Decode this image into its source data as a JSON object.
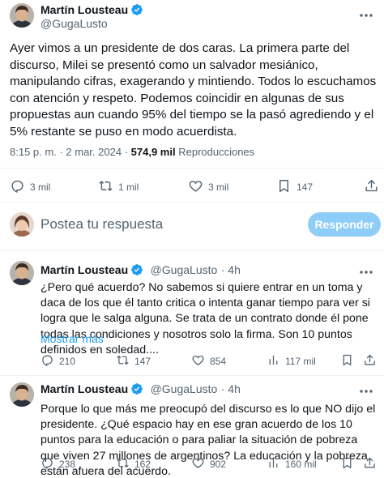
{
  "main_post": {
    "author_name": "Martín Lousteau",
    "author_handle": "@GugaLusto",
    "text": "Ayer vimos a un presidente de dos caras. La primera parte del discurso, Milei se presentó como un salvador mesiánico, manipulando cifras, exagerando y mintiendo. Todos lo escuchamos con atención y respeto. Podemos coincidir en algunas de sus propuestas aun cuando 95% del tiempo se la pasó agrediendo y el 5% restante se puso en modo acuerdista.",
    "time": "8:15 p. m.",
    "separator": "·",
    "date": "2 mar. 2024",
    "views_count": "574,9 mil",
    "views_label": "Reproducciones",
    "actions": {
      "replies": "3 mil",
      "reposts": "1 mil",
      "likes": "3 mil",
      "bookmarks": "147"
    }
  },
  "composer": {
    "placeholder": "Postea tu respuesta",
    "button_label": "Responder"
  },
  "replies": [
    {
      "author_name": "Martín Lousteau",
      "author_handle": "@GugaLusto",
      "age": "· 4h",
      "text": "¿Pero qué acuerdo? No sabemos si quiere entrar en un toma y daca de los que él tanto critica o intenta ganar tiempo para ver si logra que le salga alguna. Se trata de un contrato donde él pone todas las condiciones y nosotros solo la firma. Son 10 puntos definidos en soledad....",
      "show_more": "Mostrar más",
      "actions": {
        "replies": "210",
        "reposts": "147",
        "likes": "854",
        "views": "117 mil"
      }
    },
    {
      "author_name": "Martín Lousteau",
      "author_handle": "@GugaLusto",
      "age": "· 4h",
      "text": "Porque lo que más me preocupó del discurso es lo que NO dijo el presidente. ¿Qué espacio hay en ese gran acuerdo de los 10 puntos para la educación o para paliar la situación de pobreza que viven 27 millones de argentinos? La educación y la pobreza están afuera del acuerdo.",
      "actions": {
        "replies": "238",
        "reposts": "162",
        "likes": "902",
        "views": "160 mil"
      }
    }
  ],
  "colors": {
    "accent": "#1d9bf0",
    "muted": "#536471",
    "button_disabled": "#8ecdf8",
    "divider": "#eff3f4"
  },
  "icons": [
    "verified-badge-icon",
    "more-icon",
    "reply-icon",
    "repost-icon",
    "like-icon",
    "bookmark-icon",
    "share-icon",
    "views-icon"
  ]
}
